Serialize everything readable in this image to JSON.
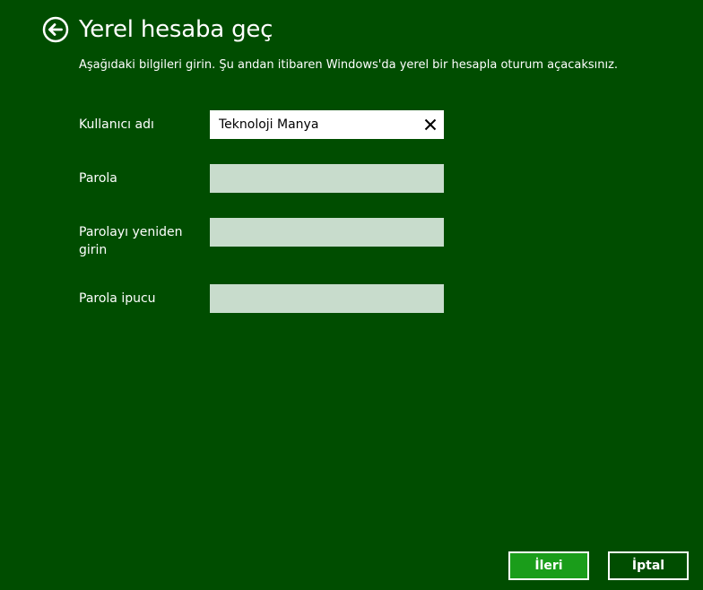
{
  "header": {
    "back_icon": "circle-arrow-left-icon",
    "title": "Yerel hesaba geç"
  },
  "subtitle": "Aşağıdaki bilgileri girin. Şu andan itibaren Windows'da yerel bir hesapla oturum açacaksınız.",
  "form": {
    "username": {
      "label": "Kullanıcı adı",
      "value": "Teknoloji Manya",
      "clear_icon": "close-icon"
    },
    "password": {
      "label": "Parola",
      "value": ""
    },
    "password_confirm": {
      "label": "Parolayı yeniden girin",
      "value": ""
    },
    "password_hint": {
      "label": "Parola ipucu",
      "value": ""
    }
  },
  "buttons": {
    "next_label": "İleri",
    "cancel_label": "İptal"
  },
  "colors": {
    "background": "#004d00",
    "input_inactive": "#c8dccc",
    "input_active": "#ffffff",
    "next_button": "#1a9d1a"
  }
}
